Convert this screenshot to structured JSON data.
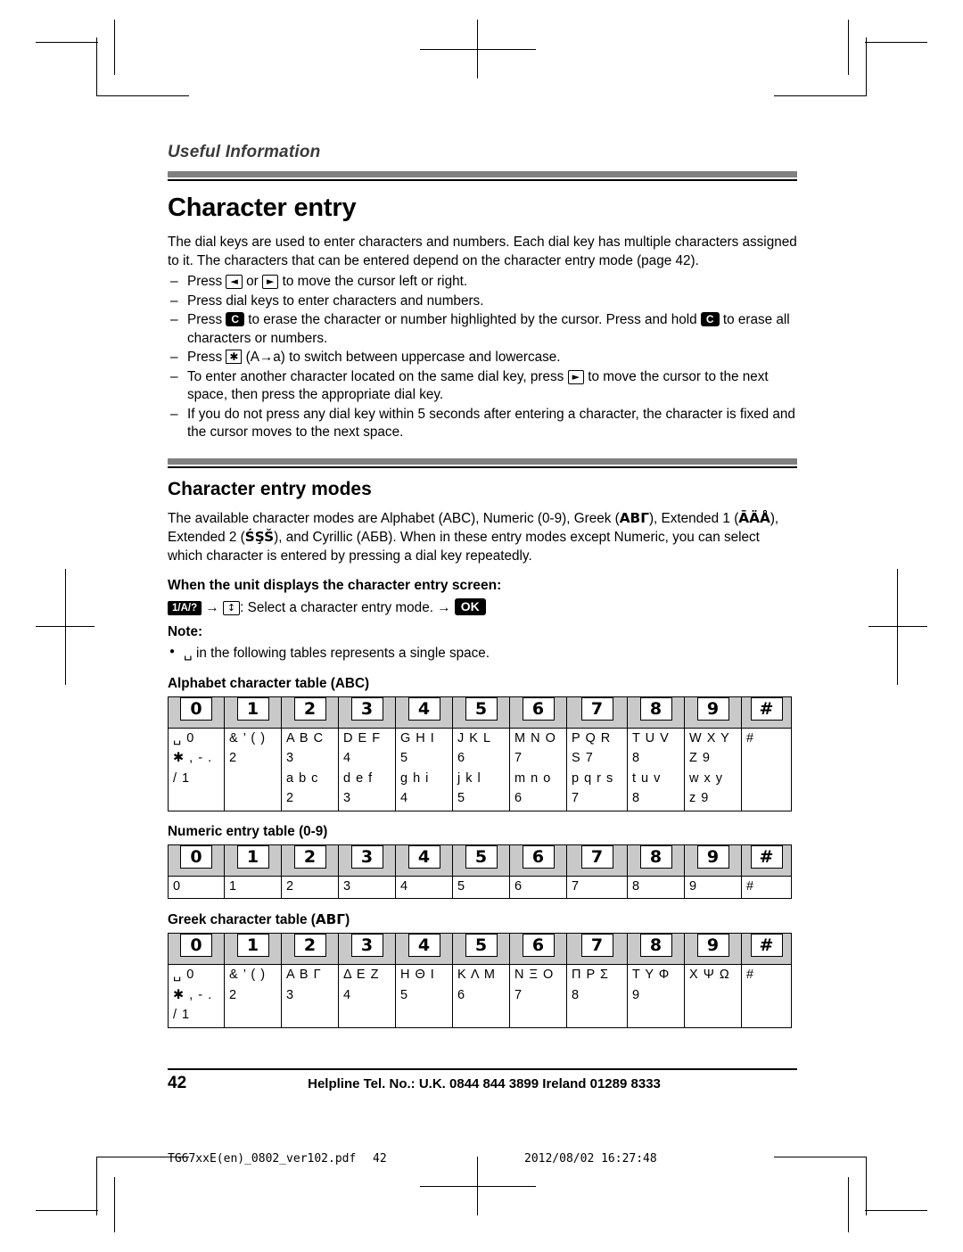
{
  "running_head": "Useful Information",
  "section_title": "Character entry",
  "intro": "The dial keys are used to enter characters and numbers. Each dial key has multiple characters assigned to it. The characters that can be entered depend on the character entry mode (page 42).",
  "bullets": [
    {
      "pre": "Press ",
      "key1": "◄",
      "mid": " or ",
      "key2": "►",
      "post": " to move the cursor left or right."
    },
    {
      "text": "Press dial keys to enter characters and numbers."
    },
    {
      "pre": "Press ",
      "key1": "C",
      "mid": " to erase the character or number highlighted by the cursor. Press and hold ",
      "key2": "C",
      "post": " to erase all characters or numbers."
    },
    {
      "pre": "Press ",
      "key1": "✱",
      "post": " (A→a) to switch between uppercase and lowercase."
    },
    {
      "pre": "To enter another character located on the same dial key, press ",
      "key1": "►",
      "post": " to move the cursor to the next space, then press the appropriate dial key."
    },
    {
      "text": "If you do not press any dial key within 5 seconds after entering a character, the character is fixed and the cursor moves to the next space."
    }
  ],
  "modes": {
    "title": "Character entry modes",
    "paragraph_parts": {
      "p1": "The available character modes are Alphabet (ABC), Numeric (0-9), Greek (",
      "greek1": "ΑΒΓ",
      "p2": "), Extended 1 (",
      "ext1": "ĀÄÅ",
      "p3": "), Extended 2 (",
      "ext2": "ŚŞŠ",
      "p4": "), and Cyrillic (АБВ). When in these entry modes except Numeric, you can select which character is entered by pressing a dial key repeatedly."
    },
    "when_head": "When the unit displays the character entry screen:",
    "select_line": {
      "mode_key": "1/A/?",
      "arrow1": "→",
      "nav_key": "↕",
      "text": ": Select a character entry mode. ",
      "arrow2": "→",
      "ok_key": "OK"
    },
    "note_head": "Note:",
    "note_item": " in the following tables represents a single space."
  },
  "tables": [
    {
      "title": "Alphabet character table (ABC)",
      "title_suffix": "",
      "keys": [
        "0",
        "1",
        "2",
        "3",
        "4",
        "5",
        "6",
        "7",
        "8",
        "9",
        "#"
      ],
      "rows": [
        [
          "␣ 0",
          "&  ’  (  )",
          "A  B  C",
          "D  E  F",
          "G  H  I",
          "J  K  L",
          "M  N  O",
          "P  Q  R",
          "T  U  V",
          "W  X  Y",
          "#"
        ],
        [
          "✱  ,  -  .",
          "2",
          "3",
          "4",
          "5",
          "6",
          "S  7",
          "8",
          "Z  9",
          "",
          ""
        ],
        [
          "/  1",
          "a  b  c",
          "d  e  f",
          "g  h  i",
          "j  k  l",
          "m  n  o",
          "p  q  r  s",
          "t  u  v",
          "w  x  y",
          "",
          ""
        ],
        [
          "2",
          "3",
          "4",
          "5",
          "6",
          "7",
          "8",
          "z  9",
          "",
          "",
          ""
        ]
      ],
      "cells": [
        [
          "␣ 0|✱ , - .|/ 1",
          "&  ’  (  )|2",
          "A  B  C|3|a  b  c|2",
          "D  E  F|4|d  e  f|3",
          "G  H  I|5|g  h  i|4",
          "J  K  L|6|j  k  l|5",
          "M  N  O|7|m  n  o|6",
          "P  Q  R|S  7|p  q  r  s|7",
          "T  U  V|8|t  u  v|8",
          "W  X  Y|Z  9|w  x  y|z  9",
          "#"
        ]
      ]
    }
  ],
  "alphabet_table": {
    "title": "Alphabet character table (ABC)",
    "keys": [
      "0",
      "1",
      "2",
      "3",
      "4",
      "5",
      "6",
      "7",
      "8",
      "9",
      "#"
    ],
    "columns": [
      [
        "␣ 0",
        "✱ , - .",
        "/ 1",
        ""
      ],
      [
        "&  ’  (  )",
        "2",
        "",
        ""
      ],
      [
        "A  B  C",
        "3",
        "a  b  c",
        "2"
      ],
      [
        "D  E  F",
        "4",
        "d  e  f",
        "3"
      ],
      [
        "G  H  I",
        "5",
        "g  h  i",
        "4"
      ],
      [
        "J  K  L",
        "6",
        "j  k  l",
        "5"
      ],
      [
        "M  N  O",
        "7",
        "m  n  o",
        "6"
      ],
      [
        "P  Q  R",
        "S  7",
        "p  q  r  s",
        "7"
      ],
      [
        "T  U  V",
        "8",
        "t  u  v",
        "8"
      ],
      [
        "W  X  Y",
        "Z  9",
        "w  x  y",
        "z  9"
      ],
      [
        "#",
        "",
        "",
        ""
      ]
    ]
  },
  "numeric_table": {
    "title": "Numeric entry table (0-9)",
    "keys": [
      "0",
      "1",
      "2",
      "3",
      "4",
      "5",
      "6",
      "7",
      "8",
      "9",
      "#"
    ],
    "values": [
      "0",
      "1",
      "2",
      "3",
      "4",
      "5",
      "6",
      "7",
      "8",
      "9",
      "#"
    ]
  },
  "greek_table": {
    "title_prefix": "Greek character table (",
    "title_symbol": "ΑΒΓ",
    "title_suffix": ")",
    "keys": [
      "0",
      "1",
      "2",
      "3",
      "4",
      "5",
      "6",
      "7",
      "8",
      "9",
      "#"
    ],
    "columns": [
      [
        "␣ 0",
        "✱ , - .",
        "/ 1",
        ""
      ],
      [
        "&  ’  (  )",
        "2",
        "",
        ""
      ],
      [
        "Α  Β  Γ",
        "3",
        "",
        ""
      ],
      [
        "Δ  Ε  Ζ",
        "4",
        "",
        ""
      ],
      [
        "Η  Θ  Ι",
        "5",
        "",
        ""
      ],
      [
        "Κ  Λ  Μ",
        "6",
        "",
        ""
      ],
      [
        "Ν  Ξ  Ο",
        "7",
        "",
        ""
      ],
      [
        "Π  Ρ  Σ",
        "8",
        "",
        ""
      ],
      [
        "Τ  Υ  Φ",
        "9",
        "",
        ""
      ],
      [
        "Χ  Ψ  Ω",
        "",
        "",
        ""
      ],
      [
        "#",
        "",
        "",
        ""
      ]
    ]
  },
  "footer": {
    "page_number": "42",
    "helpline": "Helpline Tel. No.: U.K. 0844 844 3899 Ireland 01289 8333"
  },
  "filestamp": {
    "filename": "TG67xxE(en)_0802_ver102.pdf",
    "page": "42",
    "datetime": "2012/08/02   16:27:48"
  }
}
